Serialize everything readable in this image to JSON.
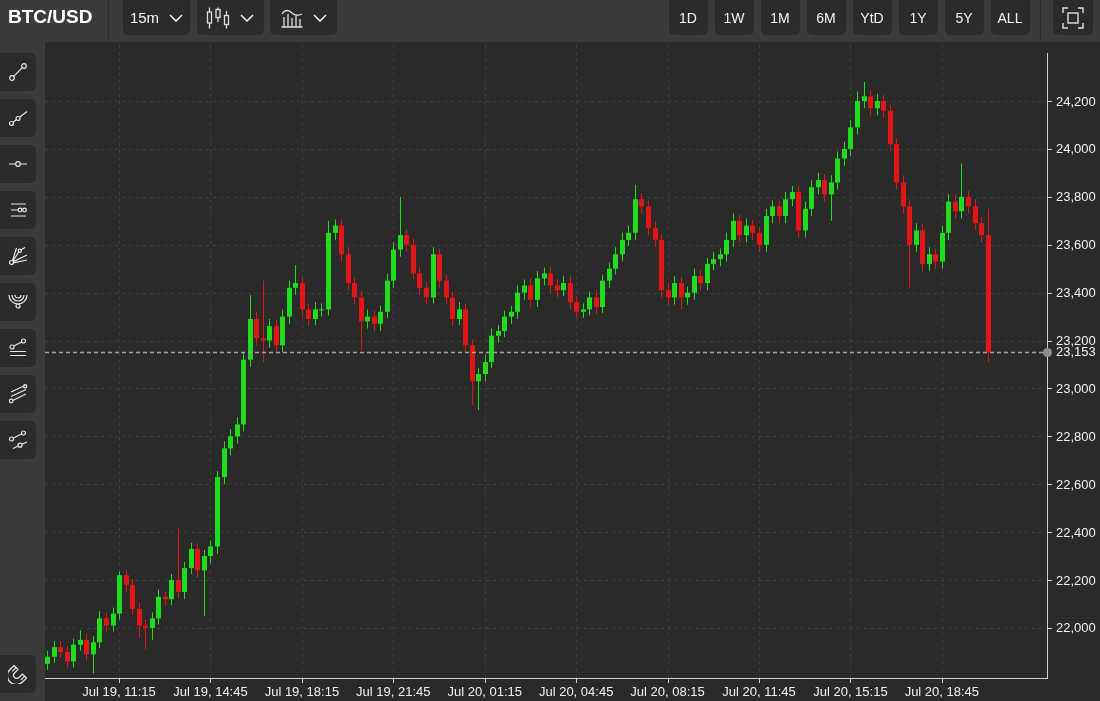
{
  "symbol": "BTC/USD",
  "interval": "15m",
  "ranges": [
    {
      "label": "1D",
      "selected": false
    },
    {
      "label": "1W",
      "selected": false
    },
    {
      "label": "1M",
      "selected": false
    },
    {
      "label": "6M",
      "selected": false
    },
    {
      "label": "YtD",
      "selected": false
    },
    {
      "label": "1Y",
      "selected": false
    },
    {
      "label": "5Y",
      "selected": false
    },
    {
      "label": "ALL",
      "selected": false
    }
  ],
  "chart": {
    "chart_data": {
      "type": "candlestick",
      "grid": true,
      "ylim": [
        21791,
        24434
      ],
      "yticks": [
        {
          "value": 22000,
          "label": "22,000"
        },
        {
          "value": 22200,
          "label": "22,200"
        },
        {
          "value": 22400,
          "label": "22,400"
        },
        {
          "value": 22600,
          "label": "22,600"
        },
        {
          "value": 22800,
          "label": "22,800"
        },
        {
          "value": 23000,
          "label": "23,000"
        },
        {
          "value": 23200,
          "label": "23,200"
        },
        {
          "value": 23400,
          "label": "23,400"
        },
        {
          "value": 23600,
          "label": "23,600"
        },
        {
          "value": 23800,
          "label": "23,800"
        },
        {
          "value": 24000,
          "label": "24,000"
        },
        {
          "value": 24200,
          "label": "24,200"
        }
      ],
      "categories": [
        null,
        null,
        null,
        null,
        null,
        null,
        null,
        null,
        null,
        null,
        null,
        "Jul 19, 11:15",
        null,
        null,
        null,
        null,
        null,
        null,
        null,
        null,
        null,
        null,
        null,
        null,
        null,
        "Jul 19, 14:45",
        null,
        null,
        null,
        null,
        null,
        null,
        null,
        null,
        null,
        null,
        null,
        null,
        null,
        "Jul 19, 18:15",
        null,
        null,
        null,
        null,
        null,
        null,
        null,
        null,
        null,
        null,
        null,
        null,
        null,
        "Jul 19, 21:45",
        null,
        null,
        null,
        null,
        null,
        null,
        null,
        null,
        null,
        null,
        null,
        null,
        null,
        "Jul 20, 01:15",
        null,
        null,
        null,
        null,
        null,
        null,
        null,
        null,
        null,
        null,
        null,
        null,
        null,
        "Jul 20, 04:45",
        null,
        null,
        null,
        null,
        null,
        null,
        null,
        null,
        null,
        null,
        null,
        null,
        null,
        "Jul 20, 08:15",
        null,
        null,
        null,
        null,
        null,
        null,
        null,
        null,
        null,
        null,
        null,
        null,
        null,
        "Jul 20, 11:45",
        null,
        null,
        null,
        null,
        null,
        null,
        null,
        null,
        null,
        null,
        null,
        null,
        null,
        "Jul 20, 15:15",
        null,
        null,
        null,
        null,
        null,
        null,
        null,
        null,
        null,
        null,
        null,
        null,
        null,
        "Jul 20, 18:45",
        null,
        null,
        null,
        null,
        null,
        null,
        null
      ],
      "ohlc": [
        [
          21850,
          21905,
          21825,
          21880
        ],
        [
          21880,
          21945,
          21855,
          21920
        ],
        [
          21920,
          21945,
          21875,
          21900
        ],
        [
          21900,
          21925,
          21835,
          21860
        ],
        [
          21860,
          21955,
          21835,
          21930
        ],
        [
          21930,
          21990,
          21905,
          21950
        ],
        [
          21950,
          21975,
          21865,
          21890
        ],
        [
          21890,
          21965,
          21810,
          21940
        ],
        [
          21940,
          22070,
          21915,
          22040
        ],
        [
          22040,
          22065,
          21985,
          22010
        ],
        [
          22010,
          22085,
          21985,
          22060
        ],
        [
          22060,
          22235,
          22035,
          22220
        ],
        [
          22220,
          22240,
          22150,
          22180
        ],
        [
          22180,
          22205,
          22055,
          22080
        ],
        [
          22080,
          22105,
          21960,
          22010
        ],
        [
          22010,
          22035,
          21910,
          22000
        ],
        [
          22000,
          22065,
          21950,
          22040
        ],
        [
          22040,
          22160,
          22015,
          22130
        ],
        [
          22130,
          22150,
          22090,
          22120
        ],
        [
          22120,
          22225,
          22095,
          22200
        ],
        [
          22200,
          22420,
          22125,
          22150
        ],
        [
          22150,
          22275,
          22120,
          22250
        ],
        [
          22250,
          22355,
          22225,
          22330
        ],
        [
          22330,
          22355,
          22210,
          22240
        ],
        [
          22240,
          22325,
          22050,
          22300
        ],
        [
          22300,
          22365,
          22270,
          22340
        ],
        [
          22340,
          22655,
          22310,
          22630
        ],
        [
          22630,
          22780,
          22600,
          22750
        ],
        [
          22750,
          22830,
          22720,
          22800
        ],
        [
          22800,
          22880,
          22770,
          22850
        ],
        [
          22850,
          23150,
          22820,
          23120
        ],
        [
          23120,
          23390,
          23090,
          23290
        ],
        [
          23290,
          23320,
          23180,
          23210
        ],
        [
          23210,
          23450,
          23110,
          23200
        ],
        [
          23200,
          23290,
          23170,
          23260
        ],
        [
          23260,
          23285,
          23150,
          23180
        ],
        [
          23180,
          23330,
          23150,
          23300
        ],
        [
          23300,
          23450,
          23270,
          23420
        ],
        [
          23420,
          23515,
          23390,
          23440
        ],
        [
          23440,
          23465,
          23300,
          23330
        ],
        [
          23330,
          23355,
          23260,
          23290
        ],
        [
          23290,
          23360,
          23265,
          23330
        ],
        [
          23330,
          23355,
          23300,
          23330
        ],
        [
          23330,
          23700,
          23305,
          23650
        ],
        [
          23650,
          23705,
          23620,
          23680
        ],
        [
          23680,
          23705,
          23530,
          23560
        ],
        [
          23560,
          23590,
          23410,
          23440
        ],
        [
          23440,
          23465,
          23350,
          23380
        ],
        [
          23380,
          23405,
          23160,
          23280
        ],
        [
          23280,
          23330,
          23250,
          23300
        ],
        [
          23300,
          23325,
          23240,
          23270
        ],
        [
          23270,
          23345,
          23240,
          23320
        ],
        [
          23320,
          23480,
          23295,
          23450
        ],
        [
          23450,
          23610,
          23420,
          23580
        ],
        [
          23580,
          23800,
          23550,
          23640
        ],
        [
          23640,
          23665,
          23570,
          23600
        ],
        [
          23600,
          23625,
          23455,
          23480
        ],
        [
          23480,
          23505,
          23390,
          23420
        ],
        [
          23420,
          23445,
          23350,
          23380
        ],
        [
          23380,
          23590,
          23355,
          23560
        ],
        [
          23560,
          23585,
          23420,
          23450
        ],
        [
          23450,
          23475,
          23350,
          23380
        ],
        [
          23380,
          23405,
          23260,
          23290
        ],
        [
          23290,
          23360,
          23265,
          23330
        ],
        [
          23330,
          23355,
          23150,
          23180
        ],
        [
          23180,
          23205,
          22930,
          23030
        ],
        [
          23030,
          23085,
          22910,
          23060
        ],
        [
          23060,
          23140,
          23030,
          23110
        ],
        [
          23110,
          23250,
          23085,
          23220
        ],
        [
          23220,
          23265,
          23190,
          23240
        ],
        [
          23240,
          23325,
          23215,
          23300
        ],
        [
          23300,
          23345,
          23270,
          23320
        ],
        [
          23320,
          23430,
          23290,
          23400
        ],
        [
          23400,
          23455,
          23370,
          23430
        ],
        [
          23430,
          23460,
          23340,
          23370
        ],
        [
          23370,
          23490,
          23340,
          23460
        ],
        [
          23460,
          23505,
          23430,
          23480
        ],
        [
          23480,
          23510,
          23400,
          23430
        ],
        [
          23430,
          23455,
          23380,
          23410
        ],
        [
          23410,
          23470,
          23385,
          23440
        ],
        [
          23440,
          23470,
          23330,
          23360
        ],
        [
          23360,
          23385,
          23295,
          23320
        ],
        [
          23320,
          23355,
          23295,
          23330
        ],
        [
          23330,
          23405,
          23305,
          23380
        ],
        [
          23380,
          23410,
          23310,
          23340
        ],
        [
          23340,
          23475,
          23315,
          23450
        ],
        [
          23450,
          23525,
          23420,
          23500
        ],
        [
          23500,
          23590,
          23475,
          23560
        ],
        [
          23560,
          23650,
          23530,
          23620
        ],
        [
          23620,
          23680,
          23595,
          23650
        ],
        [
          23650,
          23850,
          23620,
          23790
        ],
        [
          23790,
          23815,
          23730,
          23760
        ],
        [
          23760,
          23785,
          23640,
          23670
        ],
        [
          23670,
          23695,
          23590,
          23620
        ],
        [
          23620,
          23645,
          23380,
          23410
        ],
        [
          23410,
          23440,
          23350,
          23380
        ],
        [
          23380,
          23470,
          23350,
          23440
        ],
        [
          23440,
          23465,
          23330,
          23380
        ],
        [
          23380,
          23425,
          23350,
          23400
        ],
        [
          23400,
          23500,
          23370,
          23470
        ],
        [
          23470,
          23495,
          23410,
          23440
        ],
        [
          23440,
          23545,
          23410,
          23520
        ],
        [
          23520,
          23570,
          23495,
          23540
        ],
        [
          23540,
          23585,
          23510,
          23560
        ],
        [
          23560,
          23650,
          23530,
          23620
        ],
        [
          23620,
          23730,
          23590,
          23700
        ],
        [
          23700,
          23725,
          23610,
          23640
        ],
        [
          23640,
          23710,
          23610,
          23680
        ],
        [
          23680,
          23705,
          23620,
          23650
        ],
        [
          23650,
          23675,
          23570,
          23600
        ],
        [
          23600,
          23750,
          23570,
          23720
        ],
        [
          23720,
          23785,
          23690,
          23760
        ],
        [
          23760,
          23785,
          23690,
          23720
        ],
        [
          23720,
          23820,
          23690,
          23790
        ],
        [
          23790,
          23845,
          23760,
          23820
        ],
        [
          23820,
          23845,
          23630,
          23660
        ],
        [
          23660,
          23780,
          23630,
          23750
        ],
        [
          23750,
          23870,
          23720,
          23840
        ],
        [
          23840,
          23900,
          23810,
          23870
        ],
        [
          23870,
          23895,
          23780,
          23810
        ],
        [
          23810,
          23890,
          23700,
          23860
        ],
        [
          23860,
          23990,
          23830,
          23960
        ],
        [
          23960,
          24030,
          23930,
          24000
        ],
        [
          24000,
          24120,
          23970,
          24090
        ],
        [
          24090,
          24240,
          24060,
          24200
        ],
        [
          24200,
          24280,
          24170,
          24220
        ],
        [
          24220,
          24245,
          24140,
          24170
        ],
        [
          24170,
          24230,
          24140,
          24200
        ],
        [
          24200,
          24225,
          24130,
          24160
        ],
        [
          24160,
          24185,
          23990,
          24020
        ],
        [
          24020,
          24045,
          23830,
          23860
        ],
        [
          23860,
          23890,
          23730,
          23760
        ],
        [
          23760,
          23790,
          23420,
          23600
        ],
        [
          23600,
          23690,
          23570,
          23660
        ],
        [
          23660,
          23690,
          23490,
          23520
        ],
        [
          23520,
          23590,
          23490,
          23560
        ],
        [
          23560,
          23585,
          23500,
          23530
        ],
        [
          23530,
          23680,
          23500,
          23650
        ],
        [
          23650,
          23810,
          23620,
          23780
        ],
        [
          23780,
          23810,
          23710,
          23740
        ],
        [
          23740,
          23940,
          23710,
          23800
        ],
        [
          23800,
          23825,
          23730,
          23760
        ],
        [
          23760,
          23790,
          23660,
          23690
        ],
        [
          23690,
          23715,
          23610,
          23640
        ],
        [
          23640,
          23750,
          23110,
          23153
        ]
      ],
      "ref_lines": [
        {
          "axis": "y",
          "value": 23153,
          "label": "23,153"
        }
      ]
    }
  }
}
